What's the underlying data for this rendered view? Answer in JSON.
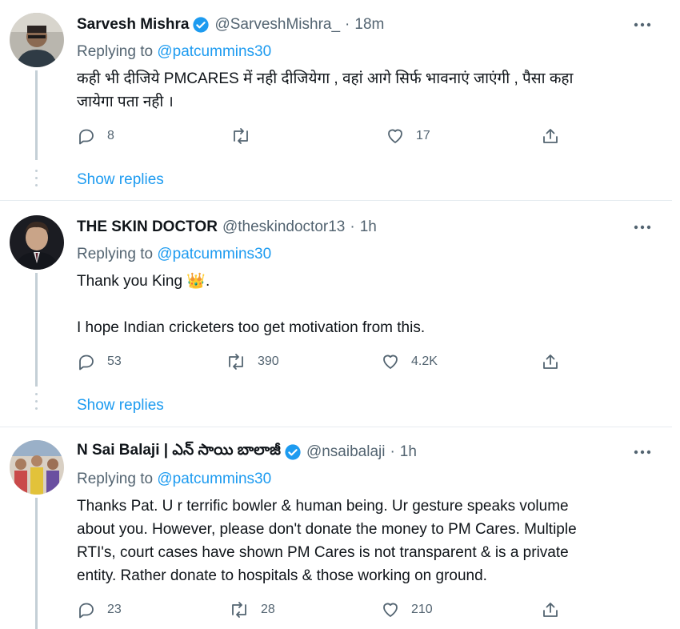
{
  "tweets": [
    {
      "name": "Sarvesh Mishra",
      "handle": "@SarveshMishra_",
      "time": "18m",
      "replying_prefix": "Replying to",
      "replying_to": "@patcummins30",
      "text_lines": [
        "कही भी दीजिये PMCARES में नही दीजियेगा , वहां आगे सिर्फ भावनाएं जाएंगी , पैसा कहा",
        "जायेगा पता नही ।"
      ],
      "reply_count": "8",
      "retweet_count": "",
      "like_count": "17",
      "show_replies": "Show replies",
      "verified": true
    },
    {
      "name": "THE SKIN DOCTOR",
      "handle": "@theskindoctor13",
      "time": "1h",
      "replying_prefix": "Replying to",
      "replying_to": "@patcummins30",
      "text_line1": "Thank you King 👑.",
      "text_line2": "I hope Indian cricketers too get motivation from this.",
      "reply_count": "53",
      "retweet_count": "390",
      "like_count": "4.2K",
      "show_replies": "Show replies",
      "verified": false
    },
    {
      "name": "N Sai Balaji | ఎన్ సాయి బాలాజీ",
      "handle": "@nsaibalaji",
      "time": "1h",
      "replying_prefix": "Replying to",
      "replying_to": "@patcummins30",
      "text_lines": [
        "Thanks Pat. U r terrific bowler & human being. Ur gesture speaks volume",
        "about you. However, please don't donate the money to PM Cares. Multiple",
        "RTI's, court cases have shown PM Cares is not transparent & is a private",
        "entity. Rather donate to hospitals & those working on ground."
      ],
      "reply_count": "23",
      "retweet_count": "28",
      "like_count": "210",
      "verified": true
    }
  ],
  "separator": "·",
  "colors": {
    "accent": "#1d9bf0",
    "secondary": "#536471",
    "text": "#0f1419"
  }
}
